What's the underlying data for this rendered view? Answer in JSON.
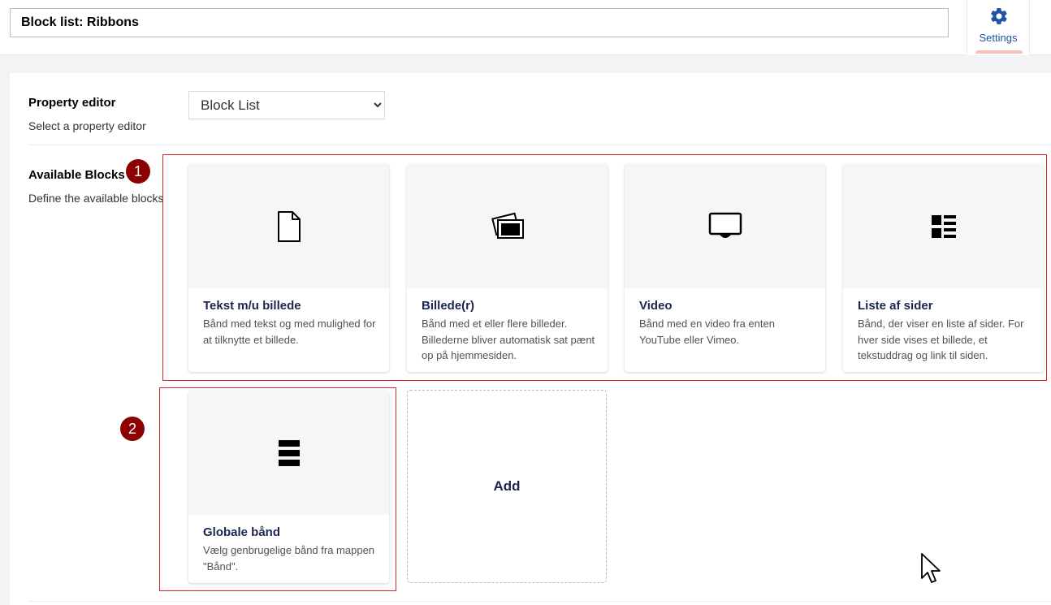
{
  "header": {
    "name_value": "Block list: Ribbons",
    "settings_tab_label": "Settings"
  },
  "property_editor": {
    "label": "Property editor",
    "description": "Select a property editor",
    "selected": "Block List"
  },
  "available_blocks": {
    "label": "Available Blocks",
    "description": "Define the available blocks"
  },
  "markers": [
    "1",
    "2"
  ],
  "blocks": [
    {
      "title": "Tekst m/u billede",
      "description": "Bånd med tekst og med mulighed for at tilknytte et billede.",
      "icon": "document-icon"
    },
    {
      "title": "Billede(r)",
      "description": "Bånd med et eller flere billeder. Billederne bliver automatisk sat pænt op på hjemmesiden.",
      "icon": "pictures-icon"
    },
    {
      "title": "Video",
      "description": "Bånd med en video fra enten YouTube eller Vimeo.",
      "icon": "monitor-icon"
    },
    {
      "title": "Liste af sider",
      "description": "Bånd, der viser en liste af sider. For hver side vises et billede, et tekstuddrag og link til siden.",
      "icon": "thumbnail-list-icon"
    },
    {
      "title": "Globale bånd",
      "description": "Vælg genbrugelige bånd fra mappen \"Bånd\".",
      "icon": "stacked-bars-icon"
    }
  ],
  "add_label": "Add",
  "colors": {
    "accent": "#2152a3",
    "marker": "#8b0000",
    "highlight_box": "#d8262b",
    "settings_underline": "#f5c1bc"
  }
}
